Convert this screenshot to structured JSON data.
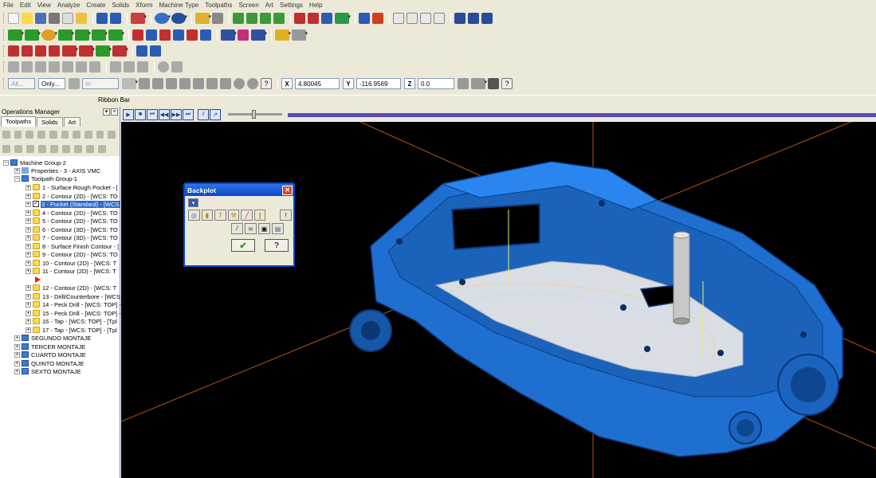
{
  "menu": [
    "File",
    "Edit",
    "View",
    "Analyze",
    "Create",
    "Solids",
    "Xform",
    "Machine Type",
    "Toolpaths",
    "Screen",
    "Art",
    "Settings",
    "Help"
  ],
  "toolbar_row4": {
    "all_btn": "All...",
    "only_btn": "Only...",
    "level_select": "In",
    "x_label": "X",
    "x_value": "4.80045",
    "y_label": "Y",
    "y_value": "-116.9569",
    "z_label": "Z",
    "z_value": "0.0"
  },
  "ribbon": {
    "label": "Ribbon Bar"
  },
  "ops": {
    "title": "Operations Manager",
    "tabs": [
      "Toolpaths",
      "Solids",
      "Art"
    ],
    "tree": [
      "Machine Group-2",
      "Properties - 3 - AXIS VMC",
      "Toolpath Group-1",
      "1 - Surface Rough Pocket - [",
      "2 - Contour (2D) - [WCS: TO",
      "3 - Pocket (Standard) - [WCS",
      "4 - Contour (2D) - [WCS: TO",
      "5 - Contour (2D) - [WCS: TO",
      "6 - Contour (3D) - [WCS: TO",
      "7 - Contour (3D) - [WCS: TO",
      "8 - Surface Finish Contour - [",
      "9 - Contour (2D) - [WCS: TO",
      "10 - Contour (2D) - [WCS: T",
      "11 - Contour (2D) - [WCS: T",
      "12 - Contour (2D) - [WCS: T",
      "13 - Drill/Counterbore - [WCS",
      "14 - Peck Drill - [WCS: TOP] -",
      "15 - Peck Drill - [WCS: TOP] -",
      "16 - Tap - [WCS: TOP] - [Tpl",
      "17 - Tap - [WCS: TOP] - [Tpl",
      "SEGUNDO MONTAJE",
      "TERCER MONTAJE",
      "CUARTO MONTAJE",
      "QUINTO MONTAJE",
      "SEXTO MONTAJE"
    ]
  },
  "dialog": {
    "title": "Backplot",
    "close": "✕",
    "ok": "✔",
    "help": "?"
  },
  "colors": {
    "part": "#1e6fd0",
    "pocket_floor": "#d9dde4",
    "tool": "#cfcfcf",
    "axis_orange": "#b5541a",
    "background": "#000000",
    "selection": "#316ac5"
  }
}
